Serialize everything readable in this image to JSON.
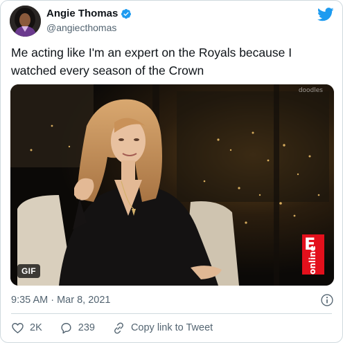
{
  "tweet": {
    "author": {
      "name": "Angie Thomas",
      "handle": "@angiecthomas",
      "verified_icon": "verified-badge-icon"
    },
    "text": "Me acting like I'm an expert on the Royals because I watched every season of the Crown",
    "media": {
      "type": "gif",
      "badge": "GIF",
      "watermark": "doodles",
      "channel_logo_letter": "E",
      "channel_logo_word": "online"
    },
    "timestamp": "9:35 AM · Mar 8, 2021",
    "actions": {
      "likes": "2K",
      "replies": "239",
      "copy_link": "Copy link to Tweet"
    }
  },
  "icons": {
    "brand": "twitter-bird-icon",
    "info": "info-icon",
    "like": "heart-icon",
    "reply": "comment-icon",
    "copy": "link-icon"
  },
  "colors": {
    "brand_blue": "#1d9bf0",
    "text_primary": "#0f1419",
    "text_secondary": "#536471",
    "border": "#cfd9de",
    "logo_red": "#e3101c"
  }
}
